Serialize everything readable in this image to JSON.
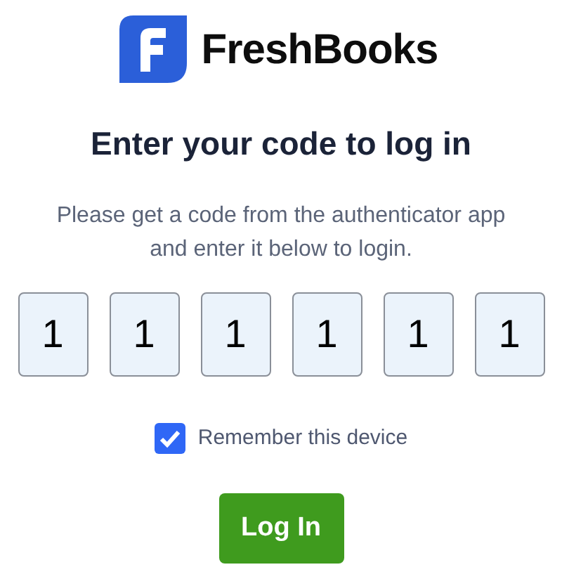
{
  "logo": {
    "text": "FreshBooks"
  },
  "heading": "Enter your code to log in",
  "instructions": "Please get a code from the authenticator app and enter it below to login.",
  "code_digits": [
    "1",
    "1",
    "1",
    "1",
    "1",
    "1"
  ],
  "remember_device": {
    "label": "Remember this device",
    "checked": true
  },
  "login_button": "Log In"
}
